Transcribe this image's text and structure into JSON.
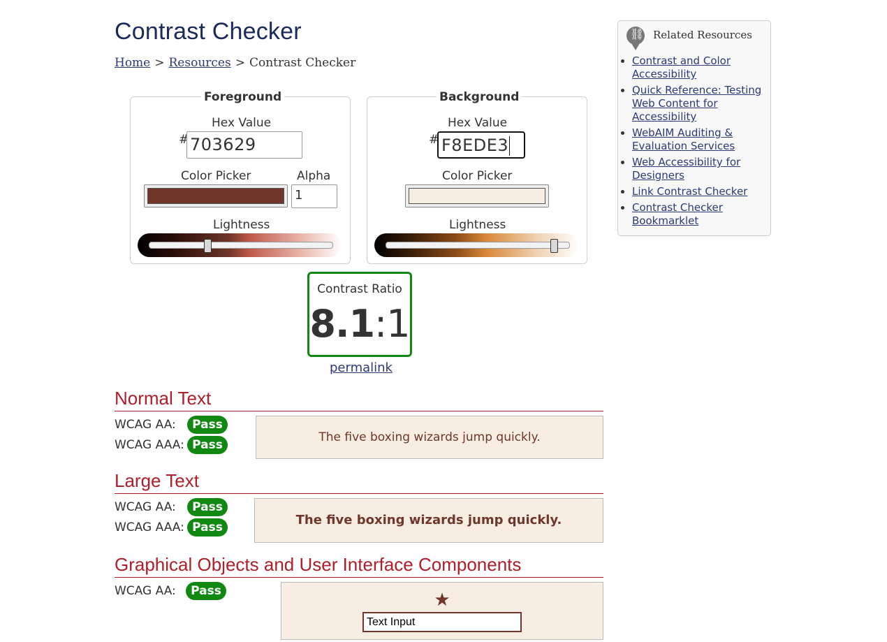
{
  "page": {
    "title": "Contrast Checker",
    "breadcrumb": [
      {
        "label": "Home",
        "link": true
      },
      {
        "label": "Resources",
        "link": true
      },
      {
        "label": "Contrast Checker",
        "link": false
      }
    ],
    "breadcrumb_separator": ">"
  },
  "foreground": {
    "legend": "Foreground",
    "hex_label": "Hex Value",
    "hash": "#",
    "hex_value": "703629",
    "picker_label": "Color Picker",
    "alpha_label": "Alpha",
    "alpha_value": "1",
    "lightness_label": "Lightness",
    "lightness_level": 0.32,
    "color": "#703629"
  },
  "background": {
    "legend": "Background",
    "hex_label": "Hex Value",
    "hash": "#",
    "hex_value": "F8EDE3",
    "picker_label": "Color Picker",
    "lightness_label": "Lightness",
    "lightness_level": 0.92,
    "color": "#F8EDE3"
  },
  "ratio": {
    "caption": "Contrast Ratio",
    "value": "8.1",
    "colon": ":",
    "suffix": "1",
    "permalink": "permalink",
    "border_color": "#118811"
  },
  "normal_text": {
    "heading": "Normal Text",
    "aa_label": "WCAG AA:",
    "aa_result": "Pass",
    "aaa_label": "WCAG AAA:",
    "aaa_result": "Pass",
    "sample": "The five boxing wizards jump quickly."
  },
  "large_text": {
    "heading": "Large Text",
    "aa_label": "WCAG AA:",
    "aa_result": "Pass",
    "aaa_label": "WCAG AAA:",
    "aaa_result": "Pass",
    "sample": "The five boxing wizards jump quickly."
  },
  "graphical": {
    "heading": "Graphical Objects and User Interface Components",
    "aa_label": "WCAG AA:",
    "aa_result": "Pass",
    "star": "★",
    "input_value": "Text Input"
  },
  "aside": {
    "heading": "Related Resources",
    "icon": "link-icon",
    "links": [
      "Contrast and Color Accessibility",
      "Quick Reference: Testing Web Content for Accessibility",
      "WebAIM Auditing & Evaluation Services",
      "Web Accessibility for Designers",
      "Link Contrast Checker",
      "Contrast Checker Bookmarklet"
    ]
  },
  "colors": {
    "pass_green": "#118811",
    "heading_red": "#b01e2a",
    "link_blue": "#2b3a78"
  }
}
